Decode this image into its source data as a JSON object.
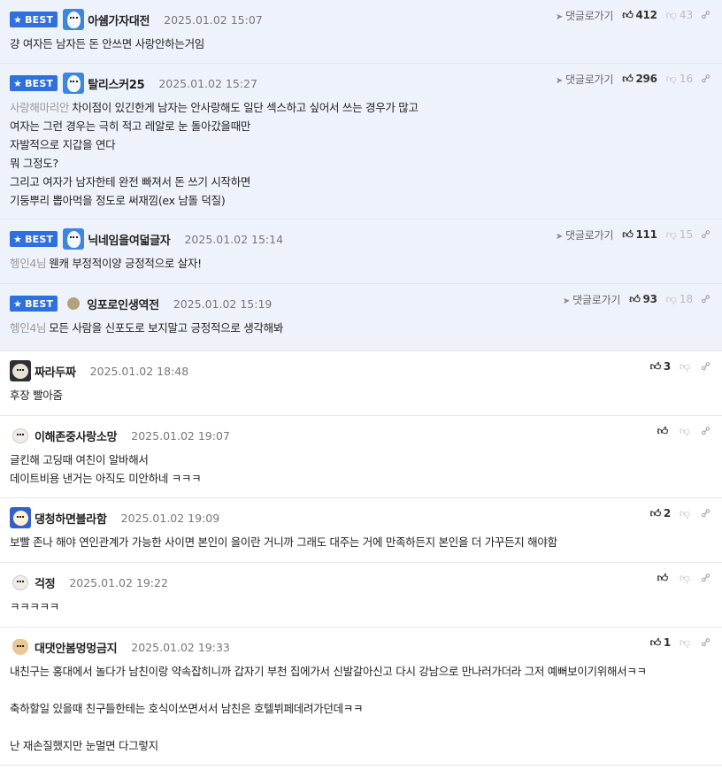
{
  "labels": {
    "best": "BEST",
    "reply": "댓글로가기"
  },
  "comments": [
    {
      "best": true,
      "avatar": "profile-blue-icon",
      "name": "아쉠가자대전",
      "date": "2025.01.02 15:07",
      "up": "412",
      "down": "43",
      "mention": "",
      "lines": [
        "걍 여자든 남자든 돈 안쓰면 사랑안하는거임"
      ]
    },
    {
      "best": true,
      "avatar": "profile-blue-icon",
      "name": "탈리스커25",
      "date": "2025.01.02 15:27",
      "up": "296",
      "down": "16",
      "mention": "사랑해마리안",
      "lines": [
        "차이점이 있긴한게 남자는 안사랑해도 일단 섹스하고 싶어서 쓰는 경우가 많고",
        "여자는 그런 경우는 극히 적고 레알로 눈 돌아갔을때만",
        "자발적으로 지갑을 연다",
        "뭐 그정도?",
        "그리고 여자가 남자한테 완전 빠져서 돈 쓰기 시작하면",
        "기둥뿌리 뽑아먹을 정도로 써재낌(ex 남돌 덕질)"
      ]
    },
    {
      "best": true,
      "avatar": "profile-blue-icon",
      "name": "닉네임을여덟글자",
      "date": "2025.01.02 15:14",
      "up": "111",
      "down": "15",
      "mention": "헹인4님",
      "lines": [
        "웬캐 부정적이양 긍정적으로 살자!"
      ]
    },
    {
      "best": true,
      "avatar": "default-dot-icon",
      "name": "잉포로인생역전",
      "date": "2025.01.02 15:19",
      "up": "93",
      "down": "18",
      "mention": "헹인4님",
      "lines": [
        "모든 사람을 신포도로 보지말고 긍정적으로 생각해봐"
      ]
    },
    {
      "best": false,
      "avatar": "dog-dark-icon",
      "name": "짜라두짜",
      "date": "2025.01.02 18:48",
      "up": "3",
      "down": "",
      "mention": "",
      "lines": [
        "후장 빨아줌"
      ]
    },
    {
      "best": false,
      "avatar": "dog-white-icon",
      "name": "이해존중사랑소망",
      "date": "2025.01.02 19:07",
      "up": "",
      "down": "",
      "mention": "",
      "lines": [
        "글킨해 고딩때 여친이 알바해서",
        "데이트비용 낸거는 아직도 미안하네 ㅋㅋㅋ"
      ]
    },
    {
      "best": false,
      "avatar": "dog-blue-icon",
      "name": "댕청하면블라함",
      "date": "2025.01.02 19:09",
      "up": "2",
      "down": "",
      "mention": "",
      "lines": [
        "보빨 존나 해야 연인관계가 가능한 사이면 본인이 을이란 거니까 그래도 대주는 거에 만족하든지 본인을 더 가꾸든지 해야함"
      ]
    },
    {
      "best": false,
      "avatar": "dog-white-icon",
      "name": "걱정",
      "date": "2025.01.02 19:22",
      "up": "",
      "down": "",
      "mention": "",
      "lines": [
        "ㅋㅋㅋㅋㅋ"
      ]
    },
    {
      "best": false,
      "avatar": "dog-tan-icon",
      "name": "대댓안봄멍멍금지",
      "date": "2025.01.02 19:33",
      "up": "1",
      "down": "",
      "mention": "",
      "lines": [
        "내친구는 홍대에서 놀다가 남친이랑 약속잡히니까 갑자기 부천 집에가서 신발갈아신고 다시 강남으로 만나러가더라 그저 예뻐보이기위해서ㅋㅋ",
        "",
        "축하할일 있을때 친구들한테는 호식이쏘면서서 남친은 호텔뷔페데려가던데ㅋㅋ",
        "",
        "난 재손질했지만 눈멀면 다그렇지"
      ]
    }
  ]
}
